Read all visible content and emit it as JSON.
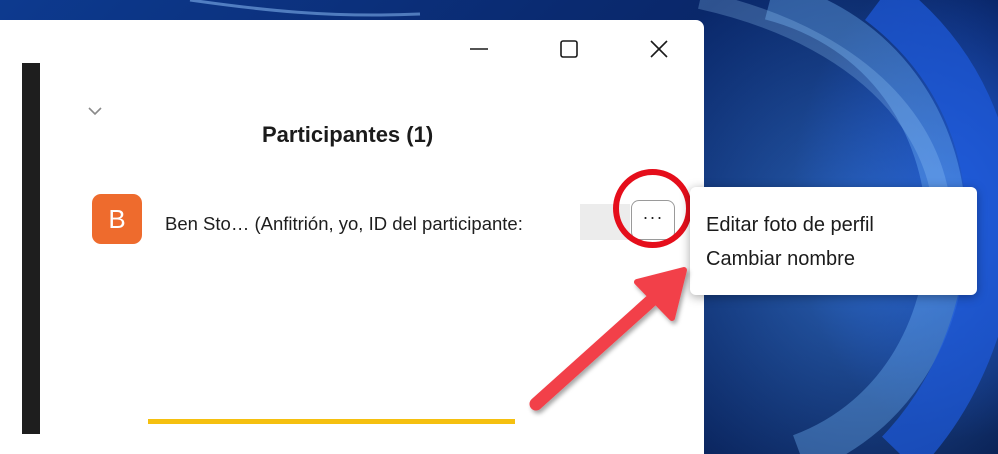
{
  "window": {
    "controls": {
      "minimize_icon": "minimize-icon",
      "maximize_icon": "maximize-icon",
      "close_icon": "close-icon"
    }
  },
  "panel": {
    "collapse_icon": "chevron-down-icon",
    "title": "Participantes (1)"
  },
  "participant": {
    "avatar_letter": "B",
    "avatar_color": "#ee6b2d",
    "name": "Ben Sto… (Anfitrión, yo, ID del participante:",
    "more_icon": "ellipsis-icon",
    "more_label": "···"
  },
  "context_menu": {
    "items": [
      {
        "label": "Editar foto de perfil"
      },
      {
        "label": "Cambiar nombre"
      }
    ]
  },
  "annotation": {
    "circle_color": "#e50e1b",
    "arrow_color": "#f2404a"
  },
  "colors": {
    "accent_line": "#f5c010"
  }
}
